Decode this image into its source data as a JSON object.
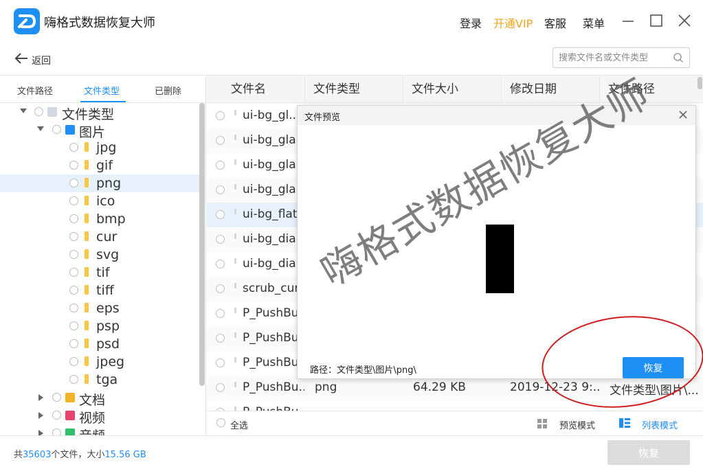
{
  "app": {
    "title": "嗨格式数据恢复大师",
    "logo_icon": "app-logo-icon",
    "accent_color": "#1e8ff5",
    "vip_color": "#f2a31b"
  },
  "topnav": {
    "login": "登录",
    "vip": "开通VIP",
    "service": "客服",
    "menu": "菜单"
  },
  "backrow": {
    "back_label": "返回",
    "search_placeholder": "搜索文件名或文件类型"
  },
  "left_tabs": [
    {
      "label": "文件路径",
      "active": false
    },
    {
      "label": "文件类型",
      "active": true
    },
    {
      "label": "已删除",
      "active": false
    }
  ],
  "tree": {
    "root_label": "文件类型",
    "images_label": "图片",
    "image_types": [
      "jpg",
      "gif",
      "png",
      "ico",
      "bmp",
      "cur",
      "svg",
      "tif",
      "tiff",
      "eps",
      "psp",
      "psd",
      "jpeg",
      "tga"
    ],
    "selected": "png",
    "docs_label": "文档",
    "video_label": "视频",
    "audio_label": "音频"
  },
  "table": {
    "headers": [
      "文件名",
      "文件类型",
      "文件大小",
      "修改日期",
      "文件路径"
    ],
    "rows": [
      {
        "name": "ui-bg_gl..."
      },
      {
        "name": "ui-bg_gla"
      },
      {
        "name": "ui-bg_gla"
      },
      {
        "name": "ui-bg_gla"
      },
      {
        "name": "ui-bg_flat"
      },
      {
        "name": "ui-bg_dia"
      },
      {
        "name": "ui-bg_dia"
      },
      {
        "name": "scrub_cur"
      },
      {
        "name": "P_PushBu"
      },
      {
        "name": "P_PushBu"
      },
      {
        "name": "P_PushBu"
      },
      {
        "name": "P_PushBu...",
        "type": "png",
        "size": "64.29 KB",
        "date": "2019-12-23 9:...",
        "path": "文件类型\\图片\\..."
      },
      {
        "name": "P_PushBu"
      }
    ]
  },
  "bottom": {
    "select_all": "全选",
    "preview_mode": "预览模式",
    "list_mode": "列表模式"
  },
  "status": {
    "prefix": "共",
    "count": "35603",
    "mid": "个文件，大小",
    "size": "15.56 GB",
    "recover_label": "恢复"
  },
  "dialog": {
    "title": "文件预览",
    "path": "路径：文件类型\\图片\\png\\",
    "recover_label": "恢复"
  },
  "watermark": "嗨格式数据恢复大师"
}
